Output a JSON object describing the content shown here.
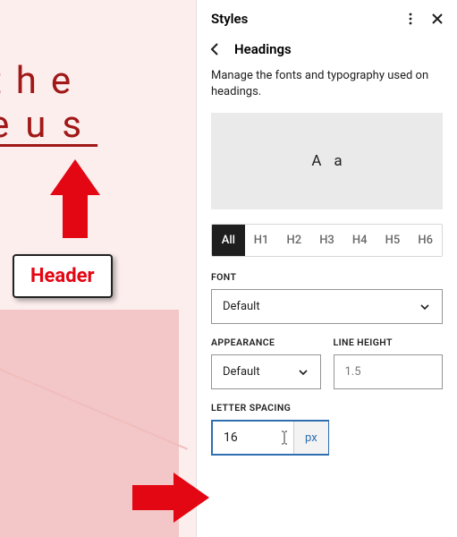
{
  "canvas": {
    "line1": "the",
    "line2": "eus",
    "callout": "Header"
  },
  "panel": {
    "title": "Styles",
    "breadcrumb": "Headings",
    "description": "Manage the fonts and typography used on headings.",
    "preview": {
      "upper": "A",
      "lower": "a"
    },
    "levels": [
      "All",
      "H1",
      "H2",
      "H3",
      "H4",
      "H5",
      "H6"
    ],
    "active_level": "All",
    "font": {
      "label": "FONT",
      "value": "Default"
    },
    "appearance": {
      "label": "APPEARANCE",
      "value": "Default"
    },
    "line_height": {
      "label": "LINE HEIGHT",
      "value": "1.5"
    },
    "letter_spacing": {
      "label": "LETTER SPACING",
      "value": "16",
      "unit": "px"
    }
  }
}
